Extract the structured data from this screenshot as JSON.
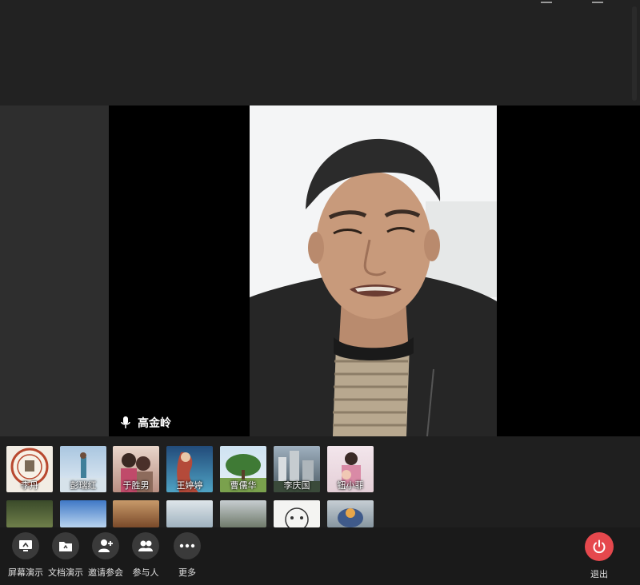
{
  "stage": {
    "speaker_name": "高金岭"
  },
  "participants_row1": [
    {
      "name": "李丹",
      "thumb": "emblem"
    },
    {
      "name": "彭瑞红",
      "thumb": "sky-figure"
    },
    {
      "name": "于胜男",
      "thumb": "couple"
    },
    {
      "name": "王婷婷",
      "thumb": "mermaid"
    },
    {
      "name": "曹儒华",
      "thumb": "tree"
    },
    {
      "name": "李庆国",
      "thumb": "city"
    },
    {
      "name": "钮小菲",
      "thumb": "mother-child"
    }
  ],
  "participants_row2": [
    {
      "name": "",
      "thumb": "dark-green"
    },
    {
      "name": "",
      "thumb": "blue-sky"
    },
    {
      "name": "",
      "thumb": "child"
    },
    {
      "name": "",
      "thumb": "family"
    },
    {
      "name": "",
      "thumb": "misty"
    },
    {
      "name": "",
      "thumb": "cartoon"
    },
    {
      "name": "",
      "thumb": "bird"
    }
  ],
  "toolbar": {
    "screen_share_label": "屏幕演示",
    "doc_share_label": "文档演示",
    "invite_label": "邀请参会",
    "participants_label": "参与人",
    "more_label": "更多",
    "exit_label": "退出"
  },
  "colors": {
    "exit_red": "#e5484d",
    "tool_circle": "#3a3a3a",
    "stage_bg": "#000000"
  }
}
